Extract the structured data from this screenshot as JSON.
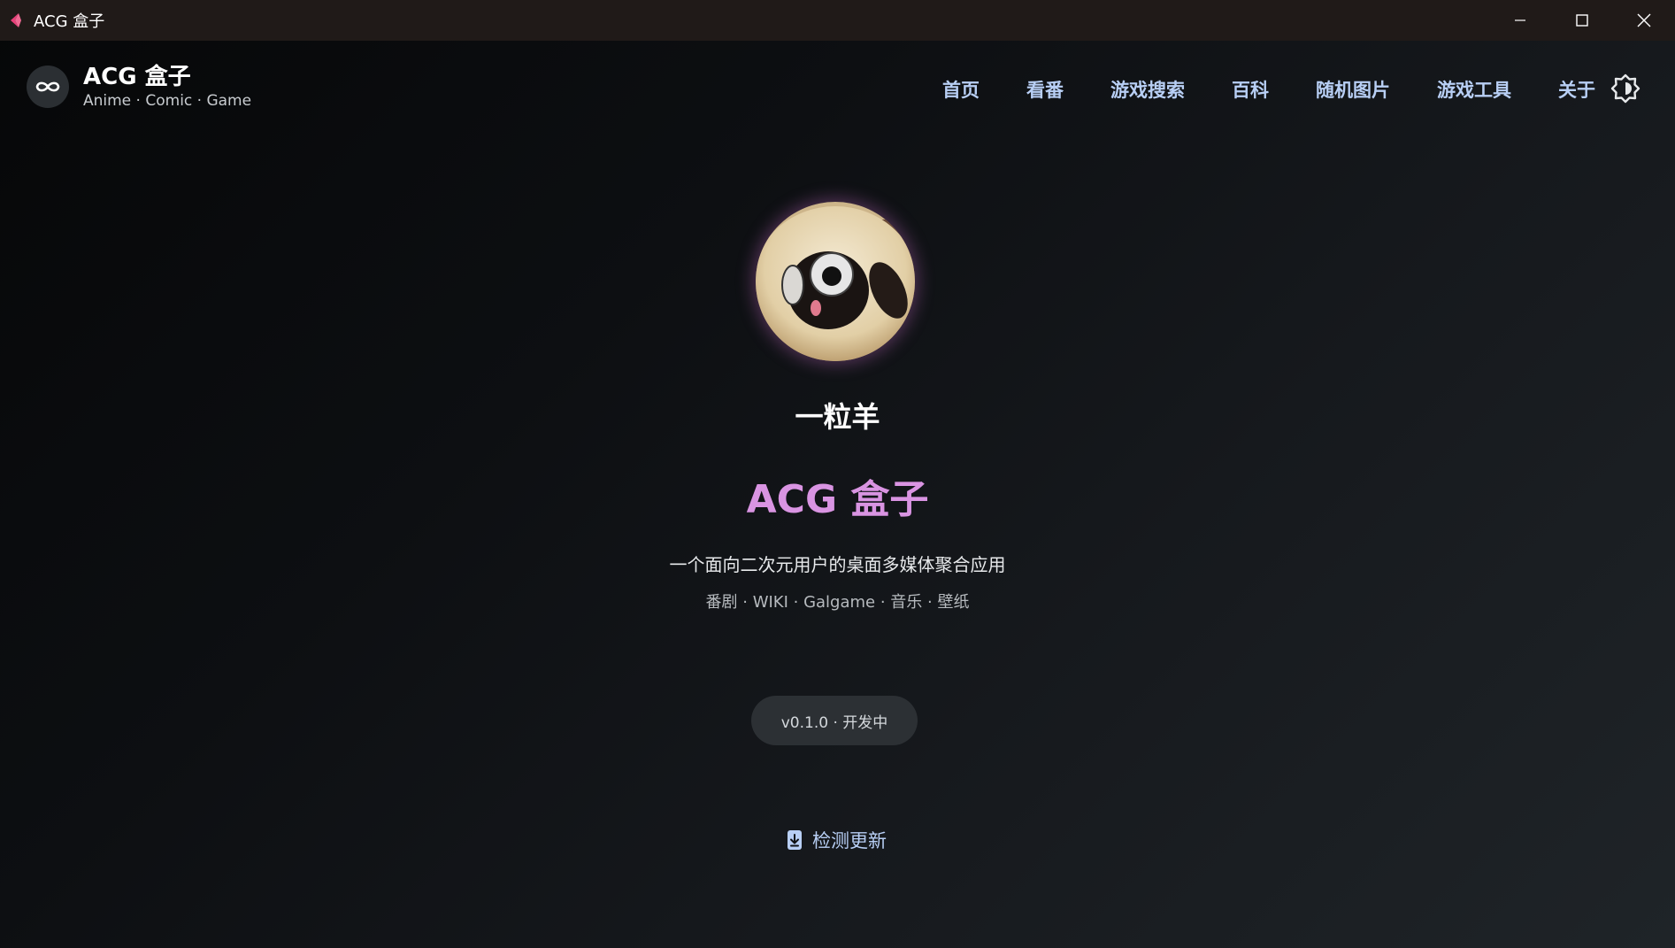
{
  "window": {
    "title": "ACG 盒子"
  },
  "header": {
    "brand_title": "ACG 盒子",
    "brand_subtitle": "Anime · Comic · Game",
    "nav": [
      {
        "label": "首页"
      },
      {
        "label": "看番"
      },
      {
        "label": "游戏搜索"
      },
      {
        "label": "百科"
      },
      {
        "label": "随机图片"
      },
      {
        "label": "游戏工具"
      },
      {
        "label": "关于"
      }
    ]
  },
  "about": {
    "user_name": "一粒羊",
    "app_name": "ACG 盒子",
    "description": "一个面向二次元用户的桌面多媒体聚合应用",
    "features": "番剧 · WIKI · Galgame · 音乐 · 壁纸",
    "version": "v0.1.0 · 开发中",
    "check_update_label": "检测更新"
  },
  "colors": {
    "accent_pink": "#d994e2",
    "nav_link": "#b8cff5",
    "titlebar_bg": "#201a18"
  },
  "icons": {
    "app": "acg-box-app-icon",
    "logo": "infinity-icon",
    "theme": "brightness-icon",
    "update": "download-icon"
  }
}
